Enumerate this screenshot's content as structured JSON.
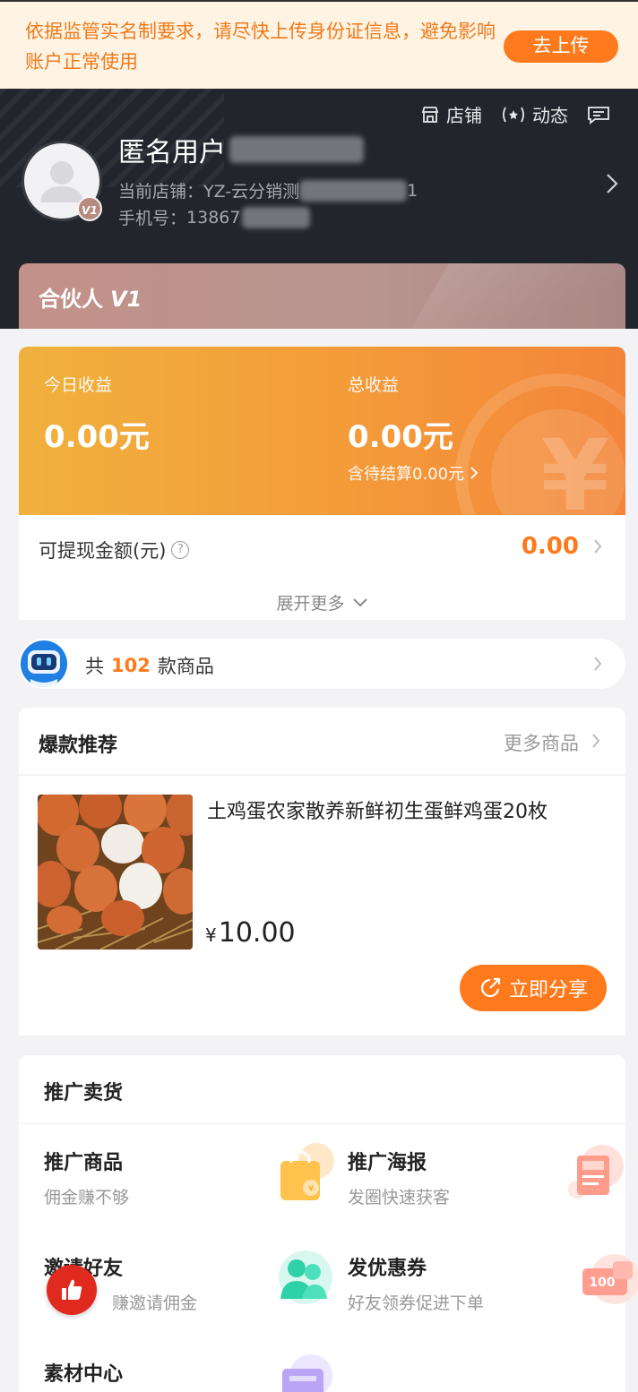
{
  "notice": {
    "text": "依据监管实名制要求，请尽快上传身份证信息，避免影响账户正常使用",
    "button": "去上传"
  },
  "header": {
    "actions": [
      {
        "label": "店铺",
        "icon": "store-icon"
      },
      {
        "label": "动态",
        "icon": "broadcast-icon"
      },
      {
        "label": "",
        "icon": "message-icon"
      }
    ],
    "user_name": "匿名用户",
    "store_label": "当前店铺：",
    "store_value": "YZ-云分销测",
    "store_suffix": "1",
    "phone_label": "手机号：",
    "phone_value": "13867",
    "avatar_badge": "V1",
    "partner_label": "合伙人",
    "partner_level": "V1"
  },
  "earnings": {
    "today_label": "今日收益",
    "today_value": "0.00元",
    "total_label": "总收益",
    "total_value": "0.00元",
    "pending_text": "含待结算0.00元",
    "withdraw_label": "可提现金额(元)",
    "withdraw_value": "0.00",
    "expand_label": "展开更多",
    "help_mark": "?",
    "yen_mark": "¥"
  },
  "product_count": {
    "prefix": "共",
    "count": "102",
    "suffix": "款商品"
  },
  "hot": {
    "title": "爆款推荐",
    "more": "更多商品",
    "product": {
      "name": "土鸡蛋农家散养新鲜初生蛋鲜鸡蛋20枚",
      "currency": "¥",
      "price": "10.00",
      "share_label": "立即分享"
    }
  },
  "promote": {
    "title": "推广卖货",
    "items": [
      {
        "title": "推广商品",
        "subtitle": "佣金赚不够",
        "icon": "shopping-bag-icon"
      },
      {
        "title": "推广海报",
        "subtitle": "发圈快速获客",
        "icon": "poster-icon"
      },
      {
        "title": "邀请好友",
        "subtitle": "赚邀请佣金",
        "icon": "users-icon"
      },
      {
        "title": "发优惠券",
        "subtitle": "好友领券促进下单",
        "icon": "coupon-icon",
        "coupon_value": "100"
      },
      {
        "title": "素材中心",
        "subtitle": "",
        "icon": "material-icon"
      }
    ]
  },
  "colors": {
    "accent": "#ff7a1c",
    "header_bg": "#23252c",
    "earn_gradient_start": "#f0b13d",
    "earn_gradient_end": "#f3853a",
    "page_bg": "#f3f3f5"
  }
}
